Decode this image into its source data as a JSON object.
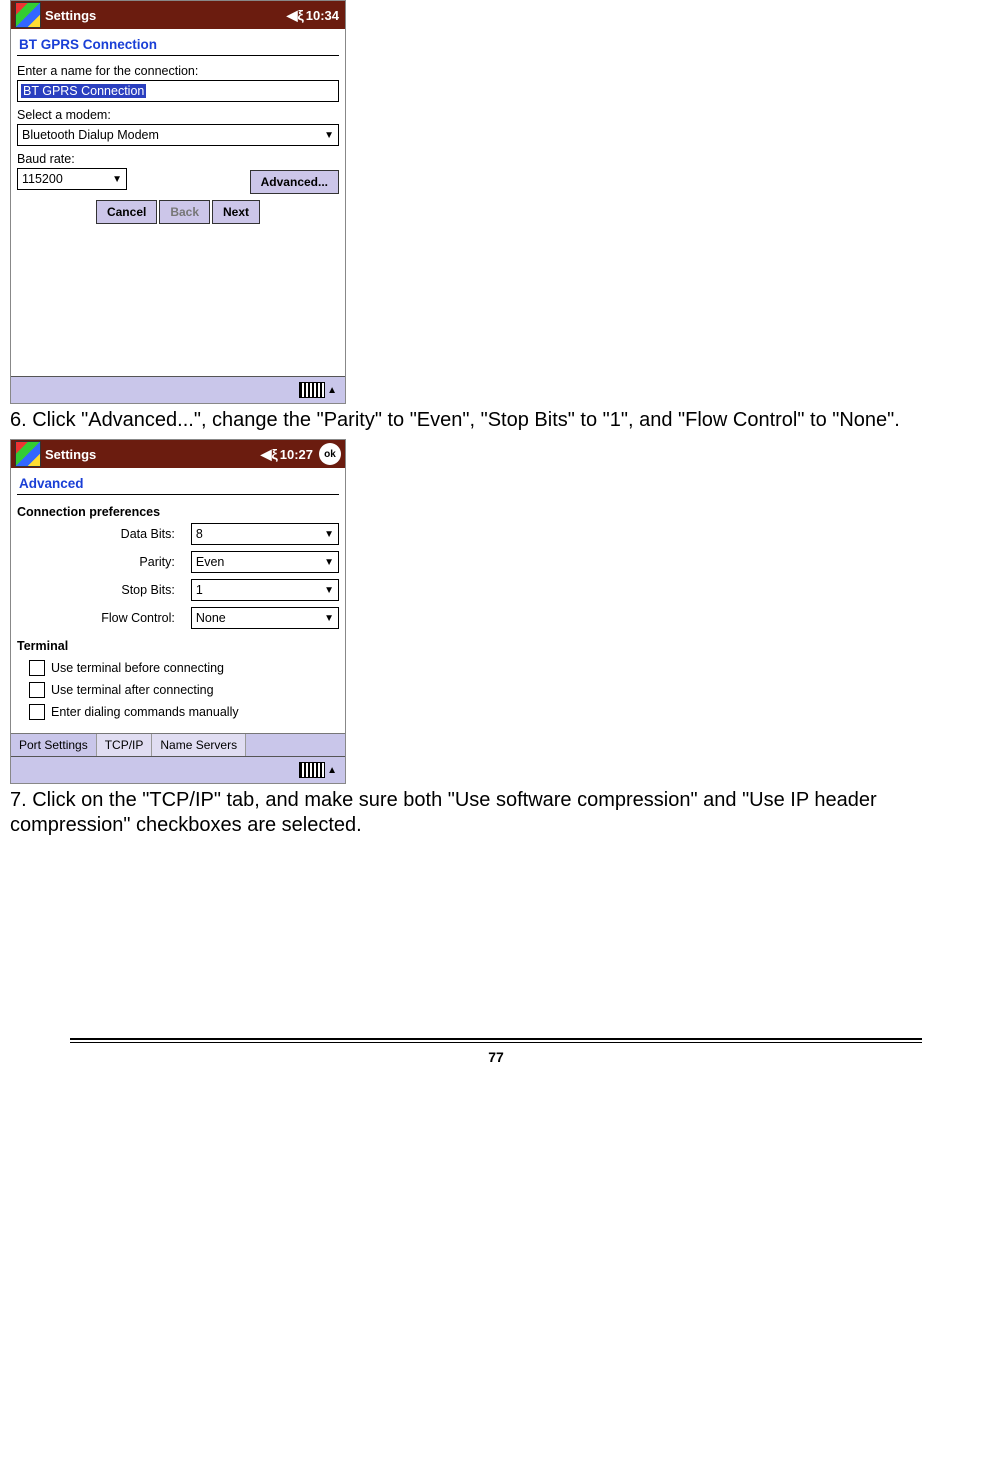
{
  "device1": {
    "titlebar": {
      "title": "Settings",
      "clock": "10:34"
    },
    "section_title": "BT GPRS Connection",
    "name_label": "Enter a name for the connection:",
    "name_value": "BT GPRS Connection",
    "modem_label": "Select a modem:",
    "modem_value": "Bluetooth Dialup Modem",
    "baud_label": "Baud rate:",
    "baud_value": "115200",
    "buttons": {
      "advanced": "Advanced...",
      "cancel": "Cancel",
      "back": "Back",
      "next": "Next"
    }
  },
  "instruction6": "6. Click \"Advanced...\", change the \"Parity\" to \"Even\", \"Stop Bits\" to \"1\", and \"Flow Control\" to \"None\".",
  "device2": {
    "titlebar": {
      "title": "Settings",
      "clock": "10:27",
      "ok": "ok"
    },
    "section_title": "Advanced",
    "conn_pref_header": "Connection preferences",
    "prefs": {
      "data_bits": {
        "label": "Data Bits:",
        "value": "8"
      },
      "parity": {
        "label": "Parity:",
        "value": "Even"
      },
      "stop_bits": {
        "label": "Stop Bits:",
        "value": "1"
      },
      "flow_control": {
        "label": "Flow Control:",
        "value": "None"
      }
    },
    "terminal_header": "Terminal",
    "checks": {
      "before": "Use terminal before connecting",
      "after": "Use terminal after connecting",
      "manual": "Enter dialing commands manually"
    },
    "tabs": {
      "t1": "Port Settings",
      "t2": "TCP/IP",
      "t3": "Name Servers"
    }
  },
  "instruction7": "7. Click on the \"TCP/IP\" tab, and make sure both \"Use software compression\" and \"Use IP header compression\" checkboxes are selected.",
  "page_number": "77"
}
